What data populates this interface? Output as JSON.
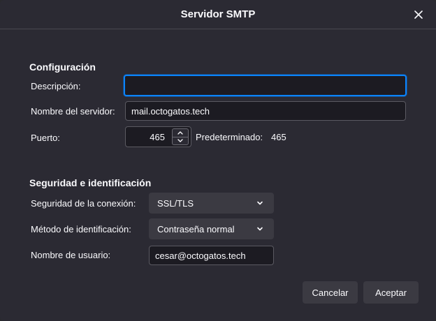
{
  "dialog": {
    "title": "Servidor SMTP",
    "close_icon": "close-icon"
  },
  "config": {
    "heading": "Configuración",
    "description_label": "Descripción:",
    "description_value": "",
    "server_label": "Nombre del servidor:",
    "server_value": "mail.octogatos.tech",
    "port_label": "Puerto:",
    "port_value": "465",
    "default_label": "Predeterminado:",
    "default_value": "465"
  },
  "security": {
    "heading": "Seguridad e identificación",
    "connection_label": "Seguridad de la conexión:",
    "connection_value": "SSL/TLS",
    "auth_label": "Método de identificación:",
    "auth_value": "Contraseña normal",
    "username_label": "Nombre de usuario:",
    "username_value": "cesar@octogatos.tech"
  },
  "buttons": {
    "cancel": "Cancelar",
    "accept": "Aceptar"
  },
  "colors": {
    "background": "#2b2a33",
    "focus_ring": "#0a84ff",
    "field_bg": "#1c1b22"
  }
}
